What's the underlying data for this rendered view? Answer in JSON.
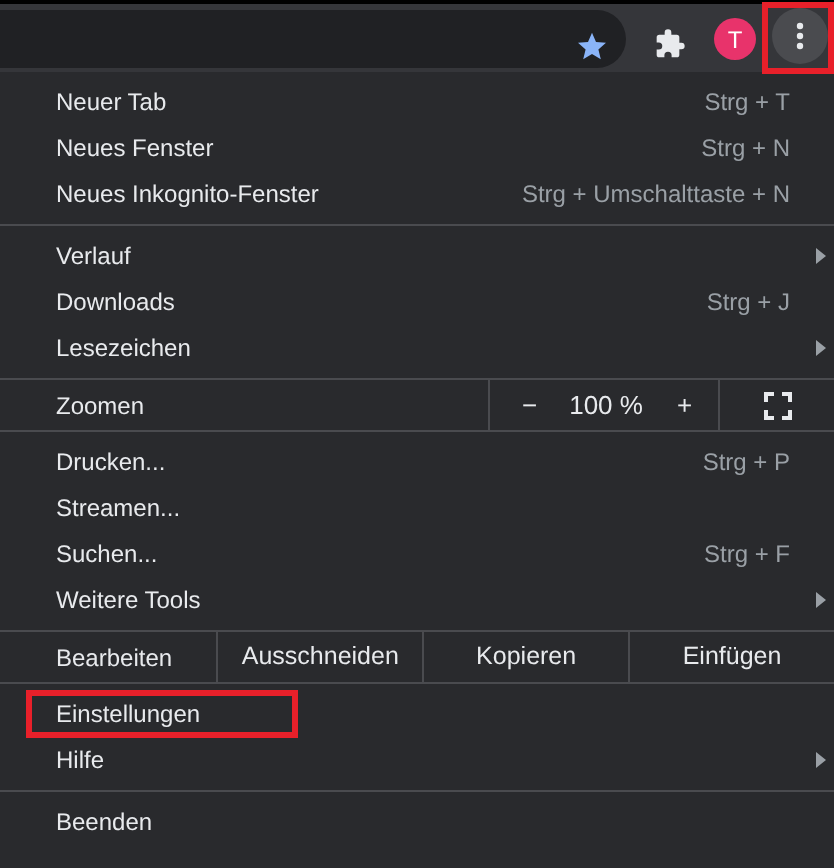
{
  "toolbar": {
    "avatar_letter": "T",
    "menu_button_highlighted": true
  },
  "menu": {
    "sections": [
      {
        "kind": "items",
        "items": [
          {
            "label": "Neuer Tab",
            "shortcut": "Strg + T",
            "submenu": false,
            "highlighted": false
          },
          {
            "label": "Neues Fenster",
            "shortcut": "Strg + N",
            "submenu": false,
            "highlighted": false
          },
          {
            "label": "Neues Inkognito-Fenster",
            "shortcut": "Strg + Umschalttaste + N",
            "submenu": false,
            "highlighted": false
          }
        ]
      },
      {
        "kind": "items",
        "items": [
          {
            "label": "Verlauf",
            "submenu": true,
            "highlighted": false
          },
          {
            "label": "Downloads",
            "shortcut": "Strg + J",
            "submenu": false,
            "highlighted": false
          },
          {
            "label": "Lesezeichen",
            "submenu": true,
            "highlighted": false
          }
        ]
      },
      {
        "kind": "zoom",
        "label": "Zoomen",
        "minus": "−",
        "value": "100 %",
        "plus": "+"
      },
      {
        "kind": "items",
        "items": [
          {
            "label": "Drucken...",
            "shortcut": "Strg + P",
            "submenu": false,
            "highlighted": false
          },
          {
            "label": "Streamen...",
            "submenu": false,
            "highlighted": false
          },
          {
            "label": "Suchen...",
            "shortcut": "Strg + F",
            "submenu": false,
            "highlighted": false
          },
          {
            "label": "Weitere Tools",
            "submenu": true,
            "highlighted": false
          }
        ]
      },
      {
        "kind": "edit",
        "label": "Bearbeiten",
        "actions": [
          "Ausschneiden",
          "Kopieren",
          "Einfügen"
        ]
      },
      {
        "kind": "items",
        "items": [
          {
            "label": "Einstellungen",
            "submenu": false,
            "highlighted": true
          },
          {
            "label": "Hilfe",
            "submenu": true,
            "highlighted": false
          }
        ]
      },
      {
        "kind": "items",
        "items": [
          {
            "label": "Beenden",
            "submenu": false,
            "highlighted": false
          }
        ]
      }
    ]
  }
}
